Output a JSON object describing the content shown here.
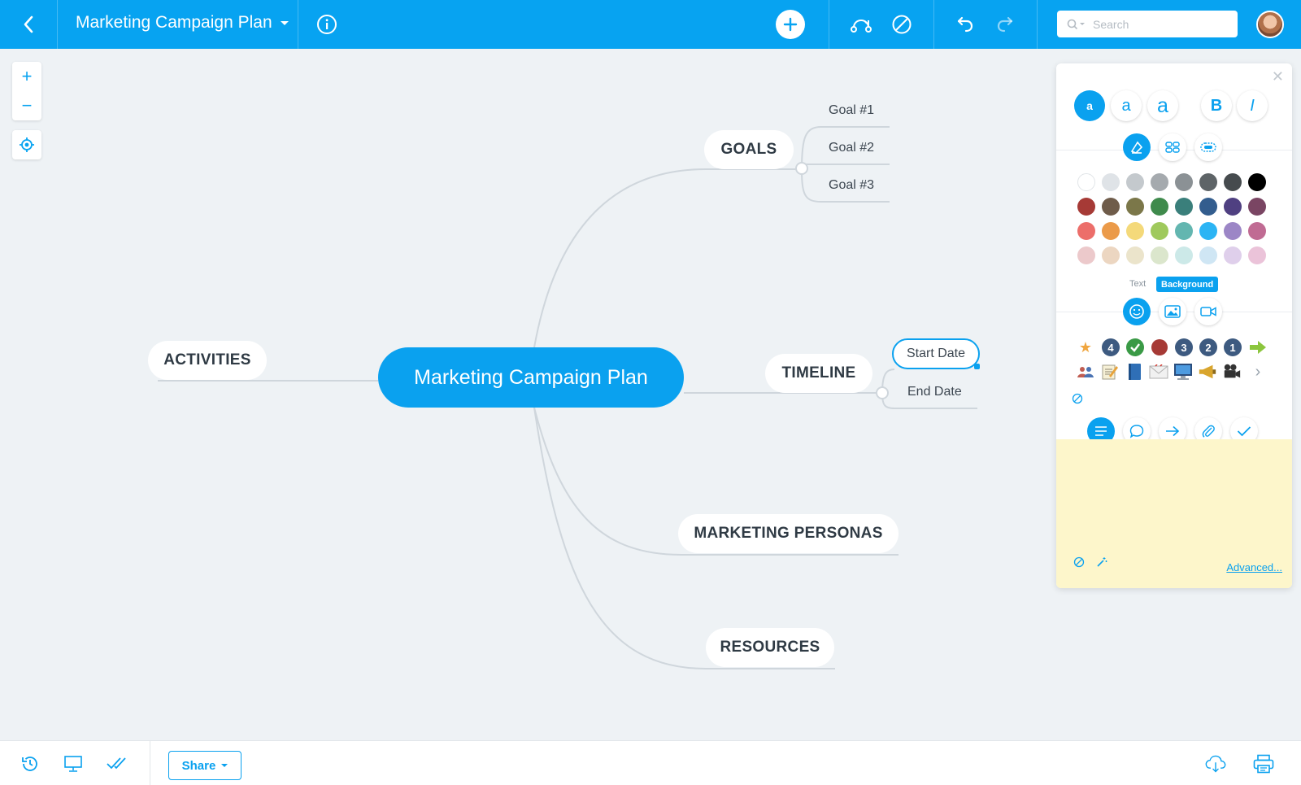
{
  "header": {
    "back_icon": "chevron-left-icon",
    "title": "Marketing Campaign Plan",
    "info_icon": "info-icon",
    "add_icon": "plus-icon",
    "branch_icon": "relationship-icon",
    "disable_icon": "no-style-icon",
    "undo_icon": "undo-icon",
    "redo_icon": "redo-icon",
    "search_placeholder": "Search",
    "accent_color": "#07a3f1"
  },
  "zoom": {
    "zoom_in": "+",
    "zoom_out": "−",
    "center_icon": "locate-icon"
  },
  "mindmap": {
    "root": "Marketing Campaign Plan",
    "branches": {
      "goals": {
        "label": "GOALS",
        "children": [
          "Goal #1",
          "Goal #2",
          "Goal #3"
        ]
      },
      "timeline": {
        "label": "TIMELINE",
        "children": [
          "Start Date",
          "End Date"
        ],
        "selected_child": "Start Date"
      },
      "personas": {
        "label": "MARKETING PERSONAS"
      },
      "resources": {
        "label": "RESOURCES"
      },
      "activities": {
        "label": "ACTIVITIES"
      }
    }
  },
  "panel": {
    "font_sizes": [
      "a",
      "a",
      "a"
    ],
    "bold": "B",
    "italic": "I",
    "color_tabs": {
      "text": "Text",
      "background": "Background",
      "active": "Background"
    },
    "swatches": [
      [
        "#ffffff",
        "#dfe3e7",
        "#c4c9cd",
        "#a5aaae",
        "#8b9195",
        "#5e6467",
        "#464b4e",
        "#000000"
      ],
      [
        "#a63a36",
        "#6f5c4a",
        "#7b7749",
        "#3f8a4c",
        "#3a7f7b",
        "#335d8e",
        "#4f4081",
        "#7a4563"
      ],
      [
        "#ec6e6a",
        "#eb9a49",
        "#f4d97a",
        "#9fc95c",
        "#63b6b0",
        "#2bb4f4",
        "#9c86c6",
        "#c06b93"
      ],
      [
        "#ecc9cb",
        "#ecd6c1",
        "#ebe4cb",
        "#dbe6cc",
        "#cce9e8",
        "#cfe6f4",
        "#dfcfeb",
        "#ebc3d9"
      ]
    ],
    "number_badges": [
      "4",
      "3",
      "2",
      "1"
    ],
    "advanced_link": "Advanced..."
  },
  "footer": {
    "share_label": "Share"
  }
}
